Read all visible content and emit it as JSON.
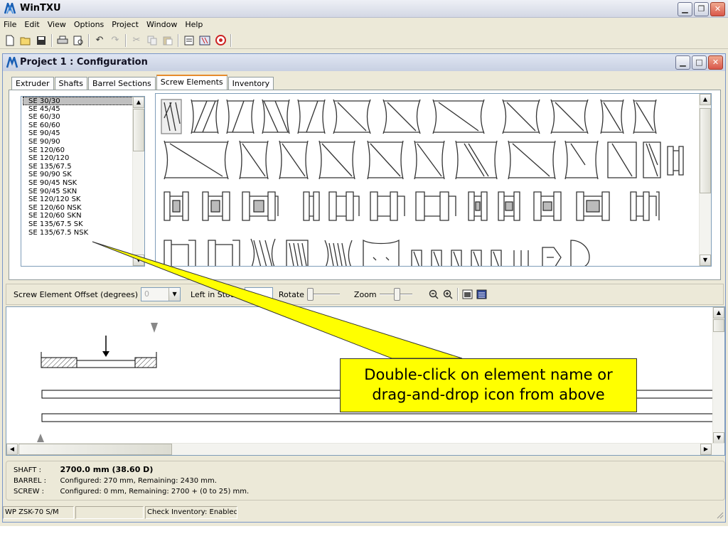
{
  "app": {
    "title": "WinTXU"
  },
  "menu": [
    "File",
    "Edit",
    "View",
    "Options",
    "Project",
    "Window",
    "Help"
  ],
  "toolbar_icons": [
    "new-file-icon",
    "open-folder-icon",
    "save-icon",
    "print-icon",
    "print-preview-icon",
    "undo-icon",
    "redo-icon",
    "cut-icon",
    "copy-icon",
    "paste-icon",
    "properties-icon",
    "screw-wizard-icon",
    "help-icon"
  ],
  "project": {
    "title": "Project 1 : Configuration",
    "tabs": [
      "Extruder",
      "Shafts",
      "Barrel Sections",
      "Screw Elements",
      "Inventory"
    ],
    "active_tab": "Screw Elements"
  },
  "element_list": {
    "items": [
      "SE 30/30",
      "SE 45/45",
      "SE 60/30",
      "SE 60/60",
      "SE 90/45",
      "SE 90/90",
      "SE 120/60",
      "SE 120/120",
      "SE 135/67.5",
      "SE 90/90 SK",
      "SE 90/45 NSK",
      "SE 90/45 SKN",
      "SE 120/120 SK",
      "SE 120/60 NSK",
      "SE 120/60 SKN",
      "SE 135/67.5 SK",
      "SE 135/67.5 NSK"
    ],
    "selected": "SE 30/30"
  },
  "options": {
    "offset_label": "Screw Element Offset (degrees)",
    "offset_value": "0",
    "stock_label": "Left in Stock:",
    "rotate_label": "Rotate",
    "zoom_label": "Zoom"
  },
  "info": {
    "shaft_label": "SHAFT :",
    "shaft_value": "2700.0 mm (38.60 D)",
    "barrel_label": "BARREL :",
    "barrel_value": "Configured: 270 mm, Remaining: 2430 mm.",
    "screw_label": "SCREW :",
    "screw_value": "Configured: 0 mm, Remaining: 2700 + (0 to 25) mm."
  },
  "status": {
    "model": "WP ZSK-70 S/M",
    "blank": "",
    "inventory": "Check Inventory: Enabled"
  },
  "callout": {
    "line1": "Double-click on element name or",
    "line2": "drag-and-drop icon from above"
  },
  "colors": {
    "callout_bg": "#ffff00",
    "active_tab_accent": "#e68b2c",
    "title_close": "#d9574a"
  }
}
